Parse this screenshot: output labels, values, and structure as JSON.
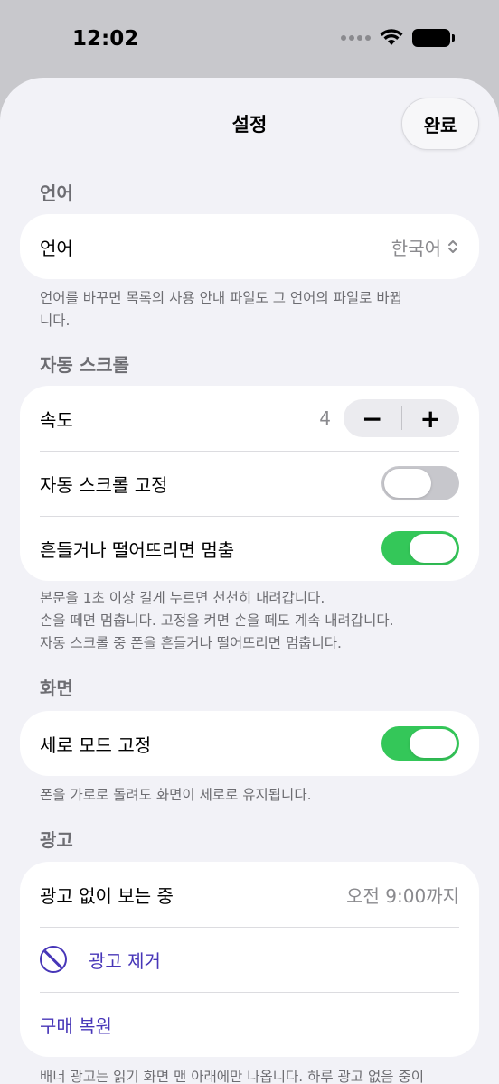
{
  "status": {
    "time": "12:02"
  },
  "nav": {
    "title": "설정",
    "done": "완료"
  },
  "language": {
    "header": "언어",
    "row_label": "언어",
    "row_value": "한국어",
    "footer": "언어를 바꾸면 목록의 사용 안내 파일도 그 언어의 파일로 바뀝니다."
  },
  "autoscroll": {
    "header": "자동 스크롤",
    "speed_label": "속도",
    "speed_value": "4",
    "minus": "−",
    "plus": "+",
    "lock_label": "자동 스크롤 고정",
    "lock_on": false,
    "shake_label": "흔들거나 떨어뜨리면 멈춤",
    "shake_on": true,
    "footer_lines": [
      "본문을 1초 이상 길게 누르면 천천히 내려갑니다.",
      "손을 떼면 멈춥니다. 고정을 켜면 손을 떼도 계속 내려갑니다.",
      "자동 스크롤 중 폰을 흔들거나 떨어뜨리면 멈춥니다."
    ]
  },
  "display": {
    "header": "화면",
    "portrait_label": "세로 모드 고정",
    "portrait_on": true,
    "footer": "폰을 가로로 돌려도 화면이 세로로 유지됩니다."
  },
  "ads": {
    "header": "광고",
    "status_label": "광고 없이 보는 중",
    "status_value": "오전 9:00까지",
    "remove_label": "광고 제거",
    "restore_label": "구매 복원",
    "footer": "배너 광고는 읽기 화면 맨 아래에만 나옵니다. 하루 광고 없음 중이"
  },
  "colors": {
    "accent": "#4736b8",
    "toggle_on": "#34c759",
    "toggle_off": "#c7c7cc"
  }
}
